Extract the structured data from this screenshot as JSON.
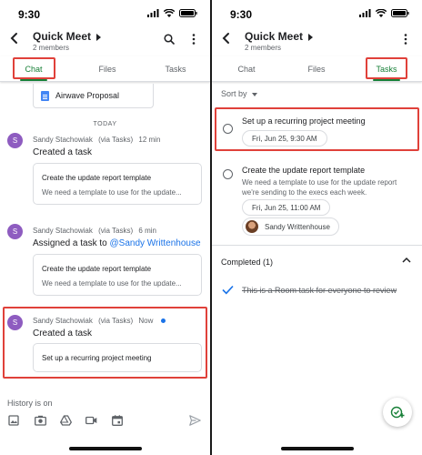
{
  "left": {
    "status": {
      "time": "9:30"
    },
    "header": {
      "title": "Quick Meet",
      "subtitle": "2 members"
    },
    "tabs": [
      {
        "label": "Chat",
        "active": true
      },
      {
        "label": "Files",
        "active": false
      },
      {
        "label": "Tasks",
        "active": false
      }
    ],
    "file_card": {
      "name": "Airwave Proposal",
      "icon": "google-docs-icon"
    },
    "date_divider": "TODAY",
    "messages": [
      {
        "avatar": "S",
        "sender": "Sandy Stachowiak",
        "via": "(via Tasks)",
        "time": "12 min",
        "text": "Created a task",
        "card": {
          "title": "Create the update report template",
          "desc": "We need a template to use for the update..."
        }
      },
      {
        "avatar": "S",
        "sender": "Sandy Stachowiak",
        "via": "(via Tasks)",
        "time": "6 min",
        "text_prefix": "Assigned a task to ",
        "mention": "@Sandy Writtenhouse",
        "card": {
          "title": "Create the update report template",
          "desc": "We need a template to use for the update..."
        }
      },
      {
        "avatar": "S",
        "sender": "Sandy Stachowiak",
        "via": "(via Tasks)",
        "time": "Now",
        "unread": true,
        "text": "Created a task",
        "card": {
          "title": "Set up a recurring project meeting"
        }
      }
    ],
    "composer": {
      "history": "History is on",
      "icons": [
        "image-icon",
        "camera-icon",
        "google-drive-icon",
        "video-icon",
        "calendar-icon",
        "send-icon"
      ]
    }
  },
  "right": {
    "status": {
      "time": "9:30"
    },
    "header": {
      "title": "Quick Meet",
      "subtitle": "2 members"
    },
    "tabs": [
      {
        "label": "Chat",
        "active": false
      },
      {
        "label": "Files",
        "active": false
      },
      {
        "label": "Tasks",
        "active": true
      }
    ],
    "sort_label": "Sort by",
    "tasks": [
      {
        "title": "Set up a recurring project meeting",
        "due": "Fri, Jun 25, 9:30 AM"
      },
      {
        "title": "Create the update report template",
        "desc_line1": "We need a template to use for the update report",
        "desc_line2": "we're sending to the execs each week.",
        "due": "Fri, Jun 25, 11:00 AM",
        "assignee": "Sandy Writtenhouse"
      }
    ],
    "completed": {
      "label": "Completed (1)",
      "items": [
        "This is a Room task for everyone to review"
      ]
    }
  },
  "colors": {
    "accent_green": "#188038",
    "highlight_red": "#e0413a",
    "link_blue": "#1a73e8",
    "avatar_purple": "#8e5cc0"
  }
}
